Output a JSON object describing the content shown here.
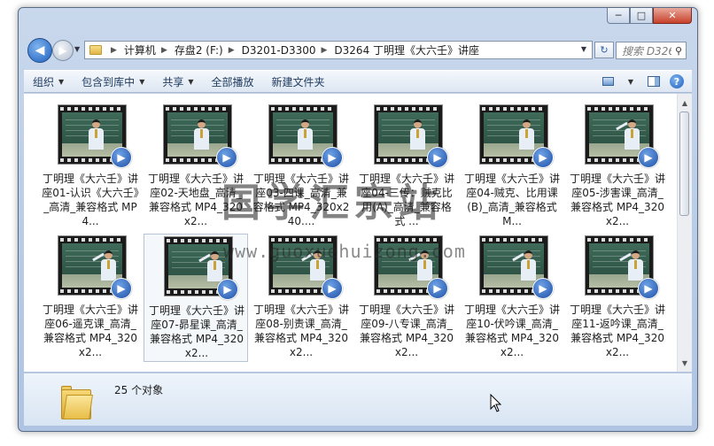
{
  "window": {
    "controls": {
      "minimize": "─",
      "maximize": "□",
      "close": "✕"
    }
  },
  "address": {
    "back_glyph": "◀",
    "forward_glyph": "▶",
    "breadcrumbs": [
      "计算机",
      "存盘2 (F:)",
      "D3201-D3300",
      "D3264 丁明理《大六壬》讲座"
    ],
    "search_placeholder": "搜索 D326...",
    "refresh_glyph": "↻"
  },
  "toolbar": {
    "organize": "组织",
    "include_in_library": "包含到库中",
    "share": "共享",
    "play_all": "全部播放",
    "new_folder": "新建文件夹",
    "help_glyph": "?"
  },
  "files": [
    {
      "name": "丁明理《大六壬》讲座01-认识《大六壬》_高清_兼容格式 MP4..."
    },
    {
      "name": "丁明理《大六壬》讲座02-天地盘_高清_兼容格式 MP4_320x2..."
    },
    {
      "name": "丁明理《大六壬》讲座03-四课_高清_兼容格式 MP4_320x240...."
    },
    {
      "name": "丁明理《大六壬》讲座04-三传：贼克比用(A)_高清_兼容格式 ..."
    },
    {
      "name": "丁明理《大六壬》讲座04-贼克、比用课(B)_高清_兼容格式 M..."
    },
    {
      "name": "丁明理《大六壬》讲座05-涉害课_高清_兼容格式 MP4_320x2..."
    },
    {
      "name": "丁明理《大六壬》讲座06-遥克课_高清_兼容格式 MP4_320x2..."
    },
    {
      "name": "丁明理《大六壬》讲座07-昴星课_高清_兼容格式 MP4_320x2..."
    },
    {
      "name": "丁明理《大六壬》讲座08-别责课_高清_兼容格式 MP4_320x2..."
    },
    {
      "name": "丁明理《大六壬》讲座09-八专课_高清_兼容格式 MP4_320x2..."
    },
    {
      "name": "丁明理《大六壬》讲座10-伏吟课_高清_兼容格式 MP4_320x2..."
    },
    {
      "name": "丁明理《大六壬》讲座11-返吟课_高清_兼容格式 MP4_320x2..."
    }
  ],
  "status": {
    "count_text": "25 个对象"
  },
  "watermark": {
    "text": "国学汇宗站",
    "url": "www.guoxuehuizong.com"
  },
  "colors": {
    "accent": "#1f5fbf",
    "toolbar_text": "#1e3a5f",
    "folder": "#e8be48"
  }
}
